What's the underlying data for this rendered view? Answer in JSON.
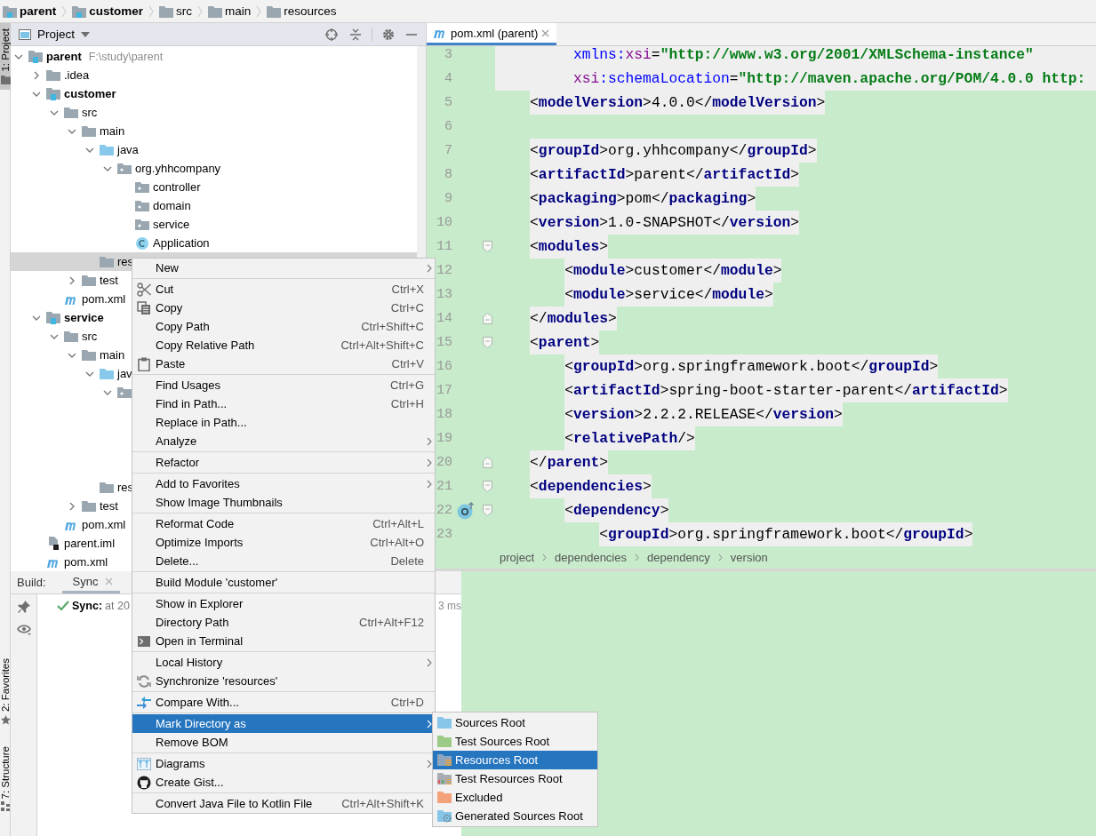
{
  "breadcrumbs": [
    {
      "label": "parent",
      "kind": "module"
    },
    {
      "label": "customer",
      "kind": "module"
    },
    {
      "label": "src",
      "kind": "folder"
    },
    {
      "label": "main",
      "kind": "folder"
    },
    {
      "label": "resources",
      "kind": "folder"
    }
  ],
  "tool_strip": [
    {
      "label": "1: Project",
      "selected": true,
      "kind": "project"
    },
    {
      "label": "2: Favorites",
      "selected": false,
      "kind": "favorites"
    },
    {
      "label": "7: Structure",
      "selected": false,
      "kind": "structure"
    }
  ],
  "project_panel": {
    "title": "Project",
    "tree": [
      {
        "label": "parent",
        "kind": "module",
        "path": "F:\\study\\parent",
        "expanded": true,
        "selected": false,
        "children": [
          {
            "label": ".idea",
            "kind": "folder",
            "expanded": false,
            "selected": false
          },
          {
            "label": "customer",
            "kind": "module",
            "expanded": true,
            "selected": false,
            "children": [
              {
                "label": "src",
                "kind": "folder",
                "expanded": true,
                "selected": false,
                "children": [
                  {
                    "label": "main",
                    "kind": "folder",
                    "expanded": true,
                    "selected": false,
                    "children": [
                      {
                        "label": "java",
                        "kind": "source",
                        "expanded": true,
                        "selected": false,
                        "children": [
                          {
                            "label": "org.yhhcompany",
                            "kind": "package",
                            "expanded": true,
                            "selected": false,
                            "children": [
                              {
                                "label": "controller",
                                "kind": "package",
                                "selected": false
                              },
                              {
                                "label": "domain",
                                "kind": "package",
                                "selected": false
                              },
                              {
                                "label": "service",
                                "kind": "package",
                                "selected": false
                              },
                              {
                                "label": "Application",
                                "kind": "class",
                                "selected": false
                              }
                            ]
                          }
                        ]
                      },
                      {
                        "label": "res",
                        "kind": "folder",
                        "selected": true
                      }
                    ]
                  },
                  {
                    "label": "test",
                    "kind": "folder",
                    "expanded": false,
                    "selected": false
                  }
                ]
              },
              {
                "label": "pom.xml",
                "kind": "maven",
                "selected": false
              }
            ]
          },
          {
            "label": "service",
            "kind": "module",
            "expanded": true,
            "selected": false,
            "children": [
              {
                "label": "src",
                "kind": "folder",
                "expanded": true,
                "selected": false,
                "children": [
                  {
                    "label": "main",
                    "kind": "folder",
                    "expanded": true,
                    "selected": false,
                    "children": [
                      {
                        "label": "jav",
                        "kind": "source",
                        "expanded": true,
                        "selected": false,
                        "children": [
                          {
                            "kind": "package",
                            "expanded": true,
                            "selected": false
                          }
                        ]
                      },
                      {
                        "label": "res",
                        "kind": "folder",
                        "selected": false
                      }
                    ]
                  },
                  {
                    "label": "test",
                    "kind": "folder",
                    "expanded": false,
                    "selected": false
                  }
                ]
              },
              {
                "label": "pom.xml",
                "kind": "maven",
                "selected": false
              }
            ]
          },
          {
            "label": "parent.iml",
            "kind": "iml",
            "selected": false
          },
          {
            "label": "pom.xml",
            "kind": "maven",
            "selected": false
          }
        ]
      }
    ]
  },
  "editor": {
    "tabs": [
      {
        "label": "pom.xml (parent)",
        "selected": true
      }
    ],
    "lines": [
      {
        "number": "3",
        "highlighted": true,
        "kind": "attribute",
        "parts": [
          {
            "kind": "attr",
            "text": "xmlns:"
          },
          {
            "kind": "ns",
            "text": "xsi"
          },
          {
            "kind": "punct",
            "text": "="
          },
          {
            "kind": "string",
            "text": "\"http://www.w3.org/2001/XMLSchema-instance\""
          }
        ]
      },
      {
        "number": "4",
        "highlighted": true,
        "kind": "attribute",
        "parts": [
          {
            "kind": "ns",
            "text": "xsi"
          },
          {
            "kind": "attr",
            "text": ":schemaLocation"
          },
          {
            "kind": "punct",
            "text": "="
          },
          {
            "kind": "string",
            "text": "\"http://maven.apache.org/POM/4.0.0 http:"
          }
        ]
      },
      {
        "number": "5",
        "highlighted": false,
        "kind": "top",
        "parts": [
          {
            "kind": "punct",
            "text": "<"
          },
          {
            "kind": "tag",
            "text": "modelVersion"
          },
          {
            "kind": "punct",
            "text": ">"
          },
          {
            "kind": "text",
            "text": "4.0.0"
          },
          {
            "kind": "punct",
            "text": "</"
          },
          {
            "kind": "tag",
            "text": "modelVersion"
          },
          {
            "kind": "punct",
            "text": ">"
          }
        ]
      },
      {
        "number": "6",
        "highlighted": false,
        "kind": "top"
      },
      {
        "number": "7",
        "highlighted": false,
        "kind": "top",
        "parts": [
          {
            "kind": "punct",
            "text": "<"
          },
          {
            "kind": "tag",
            "text": "groupId"
          },
          {
            "kind": "punct",
            "text": ">"
          },
          {
            "kind": "text",
            "text": "org.yhhcompany"
          },
          {
            "kind": "punct",
            "text": "</"
          },
          {
            "kind": "tag",
            "text": "groupId"
          },
          {
            "kind": "punct",
            "text": ">"
          }
        ]
      },
      {
        "number": "8",
        "highlighted": false,
        "kind": "top",
        "parts": [
          {
            "kind": "punct",
            "text": "<"
          },
          {
            "kind": "tag",
            "text": "artifactId"
          },
          {
            "kind": "punct",
            "text": ">"
          },
          {
            "kind": "text",
            "text": "parent"
          },
          {
            "kind": "punct",
            "text": "</"
          },
          {
            "kind": "tag",
            "text": "artifactId"
          },
          {
            "kind": "punct",
            "text": ">"
          }
        ]
      },
      {
        "number": "9",
        "highlighted": false,
        "kind": "top",
        "parts": [
          {
            "kind": "punct",
            "text": "<"
          },
          {
            "kind": "tag",
            "text": "packaging"
          },
          {
            "kind": "punct",
            "text": ">"
          },
          {
            "kind": "text",
            "text": "pom"
          },
          {
            "kind": "punct",
            "text": "</"
          },
          {
            "kind": "tag",
            "text": "packaging"
          },
          {
            "kind": "punct",
            "text": ">"
          }
        ]
      },
      {
        "number": "10",
        "highlighted": false,
        "kind": "top",
        "parts": [
          {
            "kind": "punct",
            "text": "<"
          },
          {
            "kind": "tag",
            "text": "version"
          },
          {
            "kind": "punct",
            "text": ">"
          },
          {
            "kind": "text",
            "text": "1.0-SNAPSHOT"
          },
          {
            "kind": "punct",
            "text": "</"
          },
          {
            "kind": "tag",
            "text": "version"
          },
          {
            "kind": "punct",
            "text": ">"
          }
        ]
      },
      {
        "number": "11",
        "highlighted": false,
        "fold_open": true,
        "kind": "top",
        "parts": [
          {
            "kind": "punct",
            "text": "<"
          },
          {
            "kind": "tag",
            "text": "modules"
          },
          {
            "kind": "punct",
            "text": ">"
          }
        ]
      },
      {
        "number": "12",
        "highlighted": false,
        "kind": "nested",
        "parts": [
          {
            "kind": "punct",
            "text": "<"
          },
          {
            "kind": "tag",
            "text": "module"
          },
          {
            "kind": "punct",
            "text": ">"
          },
          {
            "kind": "text",
            "text": "customer"
          },
          {
            "kind": "punct",
            "text": "</"
          },
          {
            "kind": "tag",
            "text": "module"
          },
          {
            "kind": "punct",
            "text": ">"
          }
        ]
      },
      {
        "number": "13",
        "highlighted": false,
        "kind": "nested",
        "parts": [
          {
            "kind": "punct",
            "text": "<"
          },
          {
            "kind": "tag",
            "text": "module"
          },
          {
            "kind": "punct",
            "text": ">"
          },
          {
            "kind": "text",
            "text": "service"
          },
          {
            "kind": "punct",
            "text": "</"
          },
          {
            "kind": "tag",
            "text": "module"
          },
          {
            "kind": "punct",
            "text": ">"
          }
        ]
      },
      {
        "number": "14",
        "highlighted": false,
        "fold_close": true,
        "kind": "top",
        "parts": [
          {
            "kind": "punct",
            "text": "</"
          },
          {
            "kind": "tag",
            "text": "modules"
          },
          {
            "kind": "punct",
            "text": ">"
          }
        ]
      },
      {
        "number": "15",
        "highlighted": false,
        "fold_open": true,
        "kind": "top",
        "parts": [
          {
            "kind": "punct",
            "text": "<"
          },
          {
            "kind": "tag",
            "text": "parent"
          },
          {
            "kind": "punct",
            "text": ">"
          }
        ]
      },
      {
        "number": "16",
        "highlighted": false,
        "kind": "nested",
        "parts": [
          {
            "kind": "punct",
            "text": "<"
          },
          {
            "kind": "tag",
            "text": "groupId"
          },
          {
            "kind": "punct",
            "text": ">"
          },
          {
            "kind": "text",
            "text": "org.springframework.boot"
          },
          {
            "kind": "punct",
            "text": "</"
          },
          {
            "kind": "tag",
            "text": "groupId"
          },
          {
            "kind": "punct",
            "text": ">"
          }
        ]
      },
      {
        "number": "17",
        "highlighted": false,
        "kind": "nested",
        "parts": [
          {
            "kind": "punct",
            "text": "<"
          },
          {
            "kind": "tag",
            "text": "artifactId"
          },
          {
            "kind": "punct",
            "text": ">"
          },
          {
            "kind": "text",
            "text": "spring-boot-starter-parent"
          },
          {
            "kind": "punct",
            "text": "</"
          },
          {
            "kind": "tag",
            "text": "artifactId"
          },
          {
            "kind": "punct",
            "text": ">"
          }
        ]
      },
      {
        "number": "18",
        "highlighted": false,
        "kind": "nested",
        "parts": [
          {
            "kind": "punct",
            "text": "<"
          },
          {
            "kind": "tag",
            "text": "version"
          },
          {
            "kind": "punct",
            "text": ">"
          },
          {
            "kind": "text",
            "text": "2.2.2.RELEASE"
          },
          {
            "kind": "punct",
            "text": "</"
          },
          {
            "kind": "tag",
            "text": "version"
          },
          {
            "kind": "punct",
            "text": ">"
          }
        ]
      },
      {
        "number": "19",
        "highlighted": false,
        "kind": "nested",
        "parts": [
          {
            "kind": "punct",
            "text": "<"
          },
          {
            "kind": "tag",
            "text": "relativePath"
          },
          {
            "kind": "punct",
            "text": "/>"
          }
        ]
      },
      {
        "number": "20",
        "highlighted": false,
        "fold_close": true,
        "kind": "top",
        "parts": [
          {
            "kind": "punct",
            "text": "</"
          },
          {
            "kind": "tag",
            "text": "parent"
          },
          {
            "kind": "punct",
            "text": ">"
          }
        ]
      },
      {
        "number": "21",
        "highlighted": false,
        "fold_open": true,
        "kind": "top",
        "parts": [
          {
            "kind": "punct",
            "text": "<"
          },
          {
            "kind": "tag",
            "text": "dependencies"
          },
          {
            "kind": "punct",
            "text": ">"
          }
        ]
      },
      {
        "number": "22",
        "highlighted": false,
        "fold_open": true,
        "override_marker": true,
        "kind": "nested",
        "parts": [
          {
            "kind": "punct",
            "text": "<"
          },
          {
            "kind": "tag",
            "text": "dependency"
          },
          {
            "kind": "punct",
            "text": ">"
          }
        ]
      },
      {
        "number": "23",
        "highlighted": false,
        "kind": "deep",
        "parts": [
          {
            "kind": "punct",
            "text": "<"
          },
          {
            "kind": "tag",
            "text": "groupId"
          },
          {
            "kind": "punct",
            "text": ">"
          },
          {
            "kind": "text",
            "text": "org.springframework.boot"
          },
          {
            "kind": "punct",
            "text": "</"
          },
          {
            "kind": "tag",
            "text": "groupId"
          },
          {
            "kind": "punct",
            "text": ">"
          }
        ]
      }
    ],
    "breadcrumbs": [
      "project",
      "dependencies",
      "dependency",
      "version"
    ]
  },
  "build_panel": {
    "title": "Build:",
    "tabs": [
      {
        "label": "Sync",
        "selected": true
      }
    ],
    "log": [
      {
        "kind": "success",
        "title": "Sync:",
        "text": "at 20",
        "time": "3 ms"
      }
    ]
  },
  "context_menu": {
    "groups": [
      {
        "items": [
          {
            "label": "New",
            "submenu": true,
            "selected": false
          }
        ]
      },
      {
        "items": [
          {
            "label": "Cut",
            "shortcut": "Ctrl+X",
            "kind": "scissors",
            "selected": false
          },
          {
            "label": "Copy",
            "shortcut": "Ctrl+C",
            "kind": "copy",
            "selected": false
          },
          {
            "label": "Copy Path",
            "shortcut": "Ctrl+Shift+C",
            "selected": false
          },
          {
            "label": "Copy Relative Path",
            "shortcut": "Ctrl+Alt+Shift+C",
            "selected": false
          },
          {
            "label": "Paste",
            "shortcut": "Ctrl+V",
            "kind": "paste",
            "selected": false
          }
        ]
      },
      {
        "items": [
          {
            "label": "Find Usages",
            "shortcut": "Ctrl+G",
            "selected": false
          },
          {
            "label": "Find in Path...",
            "shortcut": "Ctrl+H",
            "selected": false
          },
          {
            "label": "Replace in Path...",
            "selected": false
          },
          {
            "label": "Analyze",
            "submenu": true,
            "selected": false
          }
        ]
      },
      {
        "items": [
          {
            "label": "Refactor",
            "submenu": true,
            "selected": false
          }
        ]
      },
      {
        "items": [
          {
            "label": "Add to Favorites",
            "submenu": true,
            "selected": false
          },
          {
            "label": "Show Image Thumbnails",
            "selected": false
          }
        ]
      },
      {
        "items": [
          {
            "label": "Reformat Code",
            "shortcut": "Ctrl+Alt+L",
            "selected": false
          },
          {
            "label": "Optimize Imports",
            "shortcut": "Ctrl+Alt+O",
            "selected": false
          },
          {
            "label": "Delete...",
            "shortcut": "Delete",
            "selected": false
          }
        ]
      },
      {
        "items": [
          {
            "label": "Build Module 'customer'",
            "selected": false
          }
        ]
      },
      {
        "items": [
          {
            "label": "Show in Explorer",
            "selected": false
          },
          {
            "label": "Directory Path",
            "shortcut": "Ctrl+Alt+F12",
            "selected": false
          },
          {
            "label": "Open in Terminal",
            "kind": "terminal",
            "selected": false
          }
        ]
      },
      {
        "items": [
          {
            "label": "Local History",
            "submenu": true,
            "selected": false
          },
          {
            "label": "Synchronize 'resources'",
            "kind": "sync",
            "selected": false
          }
        ]
      },
      {
        "items": [
          {
            "label": "Compare With...",
            "shortcut": "Ctrl+D",
            "kind": "compare",
            "selected": false
          }
        ]
      },
      {
        "items": [
          {
            "label": "Mark Directory as",
            "submenu": true,
            "selected": true
          },
          {
            "label": "Remove BOM",
            "selected": false
          }
        ]
      },
      {
        "items": [
          {
            "label": "Diagrams",
            "submenu": true,
            "kind": "diagram",
            "selected": false
          },
          {
            "label": "Create Gist...",
            "kind": "cat",
            "selected": false
          }
        ]
      },
      {
        "items": [
          {
            "label": "Convert Java File to Kotlin File",
            "shortcut": "Ctrl+Alt+Shift+K",
            "selected": false
          }
        ]
      }
    ]
  },
  "submenu": [
    {
      "label": "Sources Root",
      "color": "#87c6e8",
      "kind": "plain",
      "selected": false
    },
    {
      "label": "Test Sources Root",
      "color": "#9ccb88",
      "kind": "plain",
      "selected": false
    },
    {
      "label": "Resources Root",
      "color": "#8fa5bd",
      "kind": "lines",
      "selected": true
    },
    {
      "label": "Test Resources Root",
      "color": "#a9adb3",
      "kind": "arrows",
      "selected": false
    },
    {
      "label": "Excluded",
      "color": "#f4a27a",
      "kind": "plain",
      "selected": false
    },
    {
      "label": "Generated Sources Root",
      "color": "#87c6e8",
      "kind": "gear",
      "selected": false
    }
  ]
}
